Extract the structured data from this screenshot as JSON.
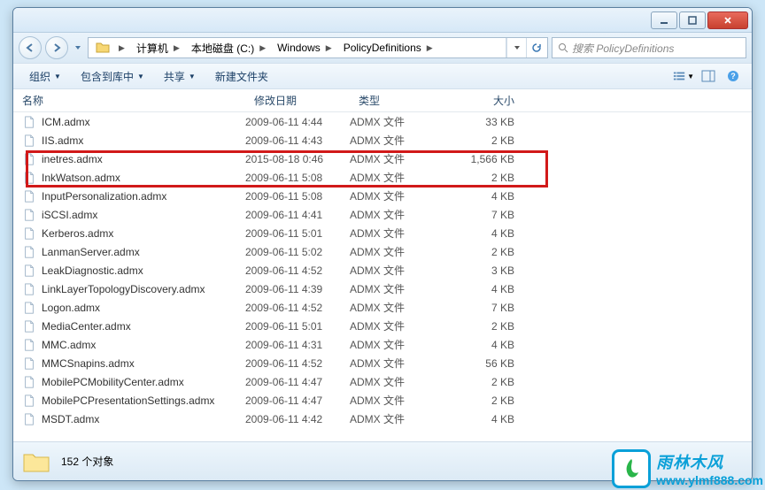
{
  "titlebar": {},
  "nav": {
    "breadcrumb": [
      "计算机",
      "本地磁盘 (C:)",
      "Windows",
      "PolicyDefinitions"
    ],
    "search_placeholder": "搜索 PolicyDefinitions"
  },
  "toolbar": {
    "organize": "组织",
    "include": "包含到库中",
    "share": "共享",
    "newfolder": "新建文件夹"
  },
  "columns": {
    "name": "名称",
    "date": "修改日期",
    "type": "类型",
    "size": "大小"
  },
  "files": [
    {
      "name": "ICM.admx",
      "date": "2009-06-11 4:44",
      "type": "ADMX 文件",
      "size": "33 KB"
    },
    {
      "name": "IIS.admx",
      "date": "2009-06-11 4:43",
      "type": "ADMX 文件",
      "size": "2 KB"
    },
    {
      "name": "inetres.admx",
      "date": "2015-08-18 0:46",
      "type": "ADMX 文件",
      "size": "1,566 KB"
    },
    {
      "name": "InkWatson.admx",
      "date": "2009-06-11 5:08",
      "type": "ADMX 文件",
      "size": "2 KB"
    },
    {
      "name": "InputPersonalization.admx",
      "date": "2009-06-11 5:08",
      "type": "ADMX 文件",
      "size": "4 KB"
    },
    {
      "name": "iSCSI.admx",
      "date": "2009-06-11 4:41",
      "type": "ADMX 文件",
      "size": "7 KB"
    },
    {
      "name": "Kerberos.admx",
      "date": "2009-06-11 5:01",
      "type": "ADMX 文件",
      "size": "4 KB"
    },
    {
      "name": "LanmanServer.admx",
      "date": "2009-06-11 5:02",
      "type": "ADMX 文件",
      "size": "2 KB"
    },
    {
      "name": "LeakDiagnostic.admx",
      "date": "2009-06-11 4:52",
      "type": "ADMX 文件",
      "size": "3 KB"
    },
    {
      "name": "LinkLayerTopologyDiscovery.admx",
      "date": "2009-06-11 4:39",
      "type": "ADMX 文件",
      "size": "4 KB"
    },
    {
      "name": "Logon.admx",
      "date": "2009-06-11 4:52",
      "type": "ADMX 文件",
      "size": "7 KB"
    },
    {
      "name": "MediaCenter.admx",
      "date": "2009-06-11 5:01",
      "type": "ADMX 文件",
      "size": "2 KB"
    },
    {
      "name": "MMC.admx",
      "date": "2009-06-11 4:31",
      "type": "ADMX 文件",
      "size": "4 KB"
    },
    {
      "name": "MMCSnapins.admx",
      "date": "2009-06-11 4:52",
      "type": "ADMX 文件",
      "size": "56 KB"
    },
    {
      "name": "MobilePCMobilityCenter.admx",
      "date": "2009-06-11 4:47",
      "type": "ADMX 文件",
      "size": "2 KB"
    },
    {
      "name": "MobilePCPresentationSettings.admx",
      "date": "2009-06-11 4:47",
      "type": "ADMX 文件",
      "size": "2 KB"
    },
    {
      "name": "MSDT.admx",
      "date": "2009-06-11 4:42",
      "type": "ADMX 文件",
      "size": "4 KB"
    }
  ],
  "status": {
    "count": "152 个对象"
  },
  "watermark": {
    "title": "雨林木风",
    "url": "www.ylmf888.com"
  }
}
